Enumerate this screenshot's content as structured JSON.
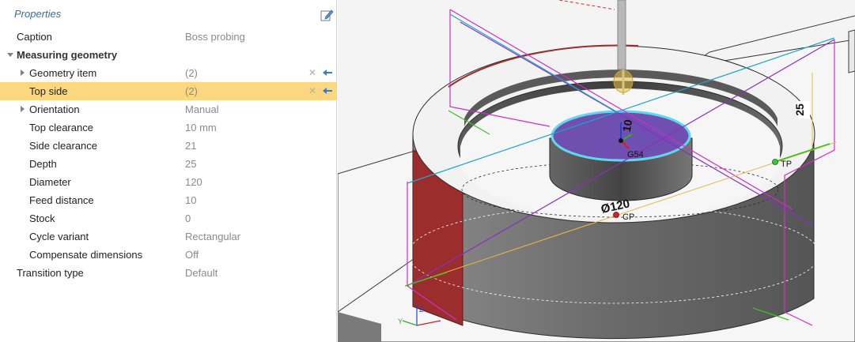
{
  "panel": {
    "title": "Properties",
    "colors": {
      "title": "#3a6ea8",
      "selection": "#fbd87f",
      "action_blue": "#3d7cc9"
    },
    "rows": [
      {
        "label": "Caption",
        "value": "Boss probing"
      },
      {
        "label": "Measuring geometry",
        "value": ""
      },
      {
        "label": "Geometry item",
        "value": "(2)"
      },
      {
        "label": "Top side",
        "value": "(2)"
      },
      {
        "label": "Orientation",
        "value": "Manual"
      },
      {
        "label": "Top clearance",
        "value": "10 mm"
      },
      {
        "label": "Side clearance",
        "value": "21"
      },
      {
        "label": "Depth",
        "value": "25"
      },
      {
        "label": "Diameter",
        "value": "120"
      },
      {
        "label": "Feed distance",
        "value": "10"
      },
      {
        "label": "Stock",
        "value": "0"
      },
      {
        "label": "Cycle variant",
        "value": "Rectangular"
      },
      {
        "label": "Compensate dimensions",
        "value": "Off"
      },
      {
        "label": "Transition type",
        "value": "Default"
      }
    ],
    "selected_row": "Top side",
    "icons": {
      "edit": "edit-note-icon",
      "expand": "triangle-right-icon",
      "collapse": "triangle-down-icon",
      "clear": "clear-x-icon",
      "pick": "pick-arrow-icon"
    }
  },
  "viewport": {
    "labels": {
      "top_clearance": "10",
      "depth": "25",
      "diameter": "Ø120",
      "origin": "G54",
      "touch_point": "TP",
      "center_point": "CP",
      "axis_z": "Z",
      "axis_y": "Y"
    },
    "colors": {
      "stock_top": "#f2f2f2",
      "stock_side": "#707070",
      "red_face": "#9c2d2d",
      "top_face": "#6f4fb0",
      "top_face_edge": "#5fd8ef",
      "magenta_line": "#d22cc8",
      "purple_line": "#8a2fc2",
      "cyan_line": "#1aa7c7",
      "green_line": "#39c21e",
      "yellow_line": "#e8b845",
      "probe": "#b8b8b8"
    }
  }
}
